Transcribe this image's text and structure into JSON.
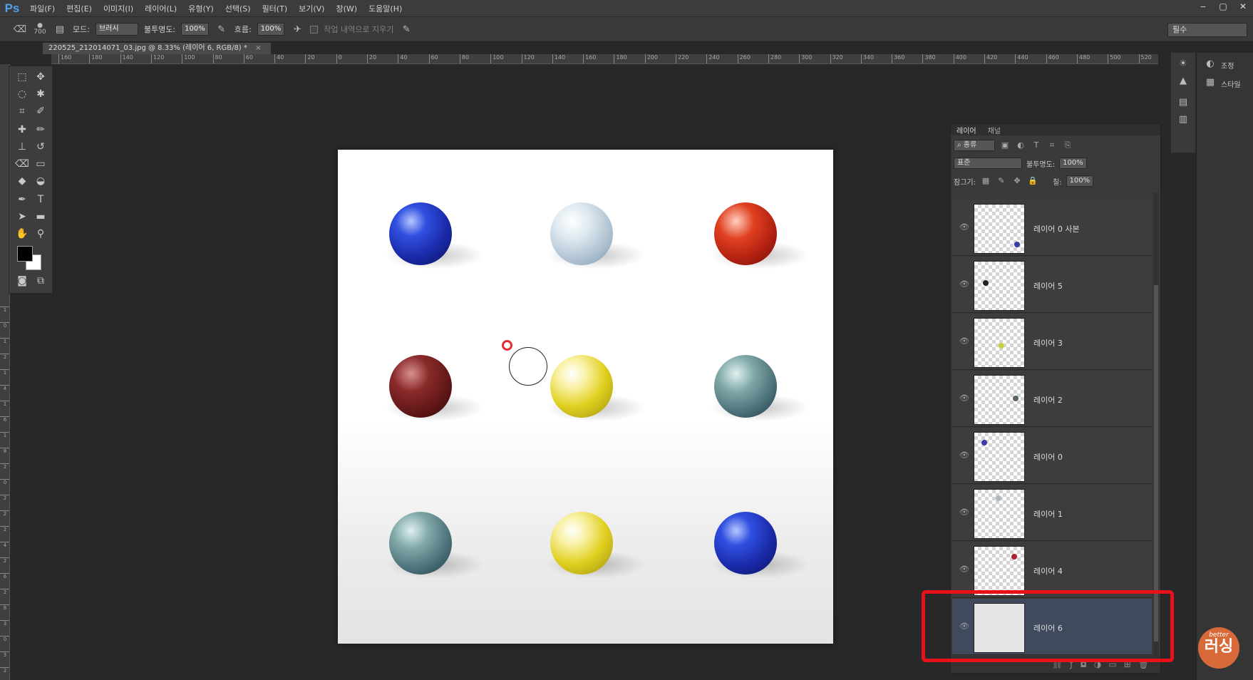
{
  "app": {
    "logo": "Ps",
    "menu": [
      "파일(F)",
      "편집(E)",
      "이미지(I)",
      "레이어(L)",
      "유형(Y)",
      "선택(S)",
      "필터(T)",
      "보기(V)",
      "창(W)",
      "도움말(H)"
    ],
    "window_controls": [
      "‒",
      "▢",
      "✕"
    ]
  },
  "options_bar": {
    "brush_size": "700",
    "mode_label": "모드:",
    "mode_value": "브러시",
    "opacity_label": "불투명도:",
    "opacity_value": "100%",
    "flow_label": "흐름:",
    "flow_value": "100%",
    "erase_history_label": "작업 내역으로 지우기",
    "workspace": "필수"
  },
  "document": {
    "tab_title": "220525_212014071_03.jpg @ 8.33% (레이어 6, RGB/8) *",
    "close": "×"
  },
  "ruler_top": [
    "160",
    "180",
    "140",
    "120",
    "100",
    "80",
    "60",
    "40",
    "20",
    "0",
    "20",
    "40",
    "60",
    "80",
    "100",
    "120",
    "140",
    "160",
    "180",
    "200",
    "220",
    "240",
    "260",
    "280",
    "300",
    "320",
    "340",
    "360",
    "380",
    "400",
    "420",
    "440",
    "460",
    "480",
    "500",
    "520"
  ],
  "ruler_left": [
    "1",
    "0",
    "1",
    "2",
    "1",
    "4",
    "1",
    "6",
    "1",
    "8",
    "2",
    "0",
    "2",
    "2",
    "2",
    "4",
    "2",
    "6",
    "2",
    "8",
    "3",
    "0",
    "3",
    "2"
  ],
  "layers_panel": {
    "tabs": [
      "레이어",
      "채널"
    ],
    "filter_label": "종류",
    "blend_mode": "표준",
    "opacity_label": "불투명도:",
    "opacity_value": "100%",
    "lock_label": "잠그기:",
    "fill_label": "칠:",
    "fill_value": "100%",
    "layers": [
      {
        "name": "레이어 0 사본",
        "dot_color": "#3a3aa8",
        "selected": false
      },
      {
        "name": "레이어 5",
        "dot_color": "#222222",
        "selected": false
      },
      {
        "name": "레이어 3",
        "dot_color": "#c8d040",
        "selected": false
      },
      {
        "name": "레이어 2",
        "dot_color": "#556666",
        "selected": false
      },
      {
        "name": "레이어 0",
        "dot_color": "#3a3aa8",
        "selected": false
      },
      {
        "name": "레이어 1",
        "dot_color": "#b0b8c0",
        "selected": false
      },
      {
        "name": "레이어 4",
        "dot_color": "#b02030",
        "selected": false
      },
      {
        "name": "레이어 6",
        "dot_color": "",
        "selected": true
      }
    ]
  },
  "dock": {
    "items": [
      {
        "label": "조정",
        "icon": "adjustments-icon"
      },
      {
        "label": "스타일",
        "icon": "styles-icon"
      }
    ]
  },
  "watermark": {
    "top": "better",
    "main": "러싱"
  },
  "canvas_marbles": [
    {
      "color": "blue-swirl"
    },
    {
      "color": "clear-frost"
    },
    {
      "color": "red-swirl"
    },
    {
      "color": "dark-red"
    },
    {
      "color": "yellow-flower"
    },
    {
      "color": "teal-speckle"
    },
    {
      "color": "teal-speckle"
    },
    {
      "color": "yellow-flower"
    },
    {
      "color": "blue-swirl"
    }
  ]
}
